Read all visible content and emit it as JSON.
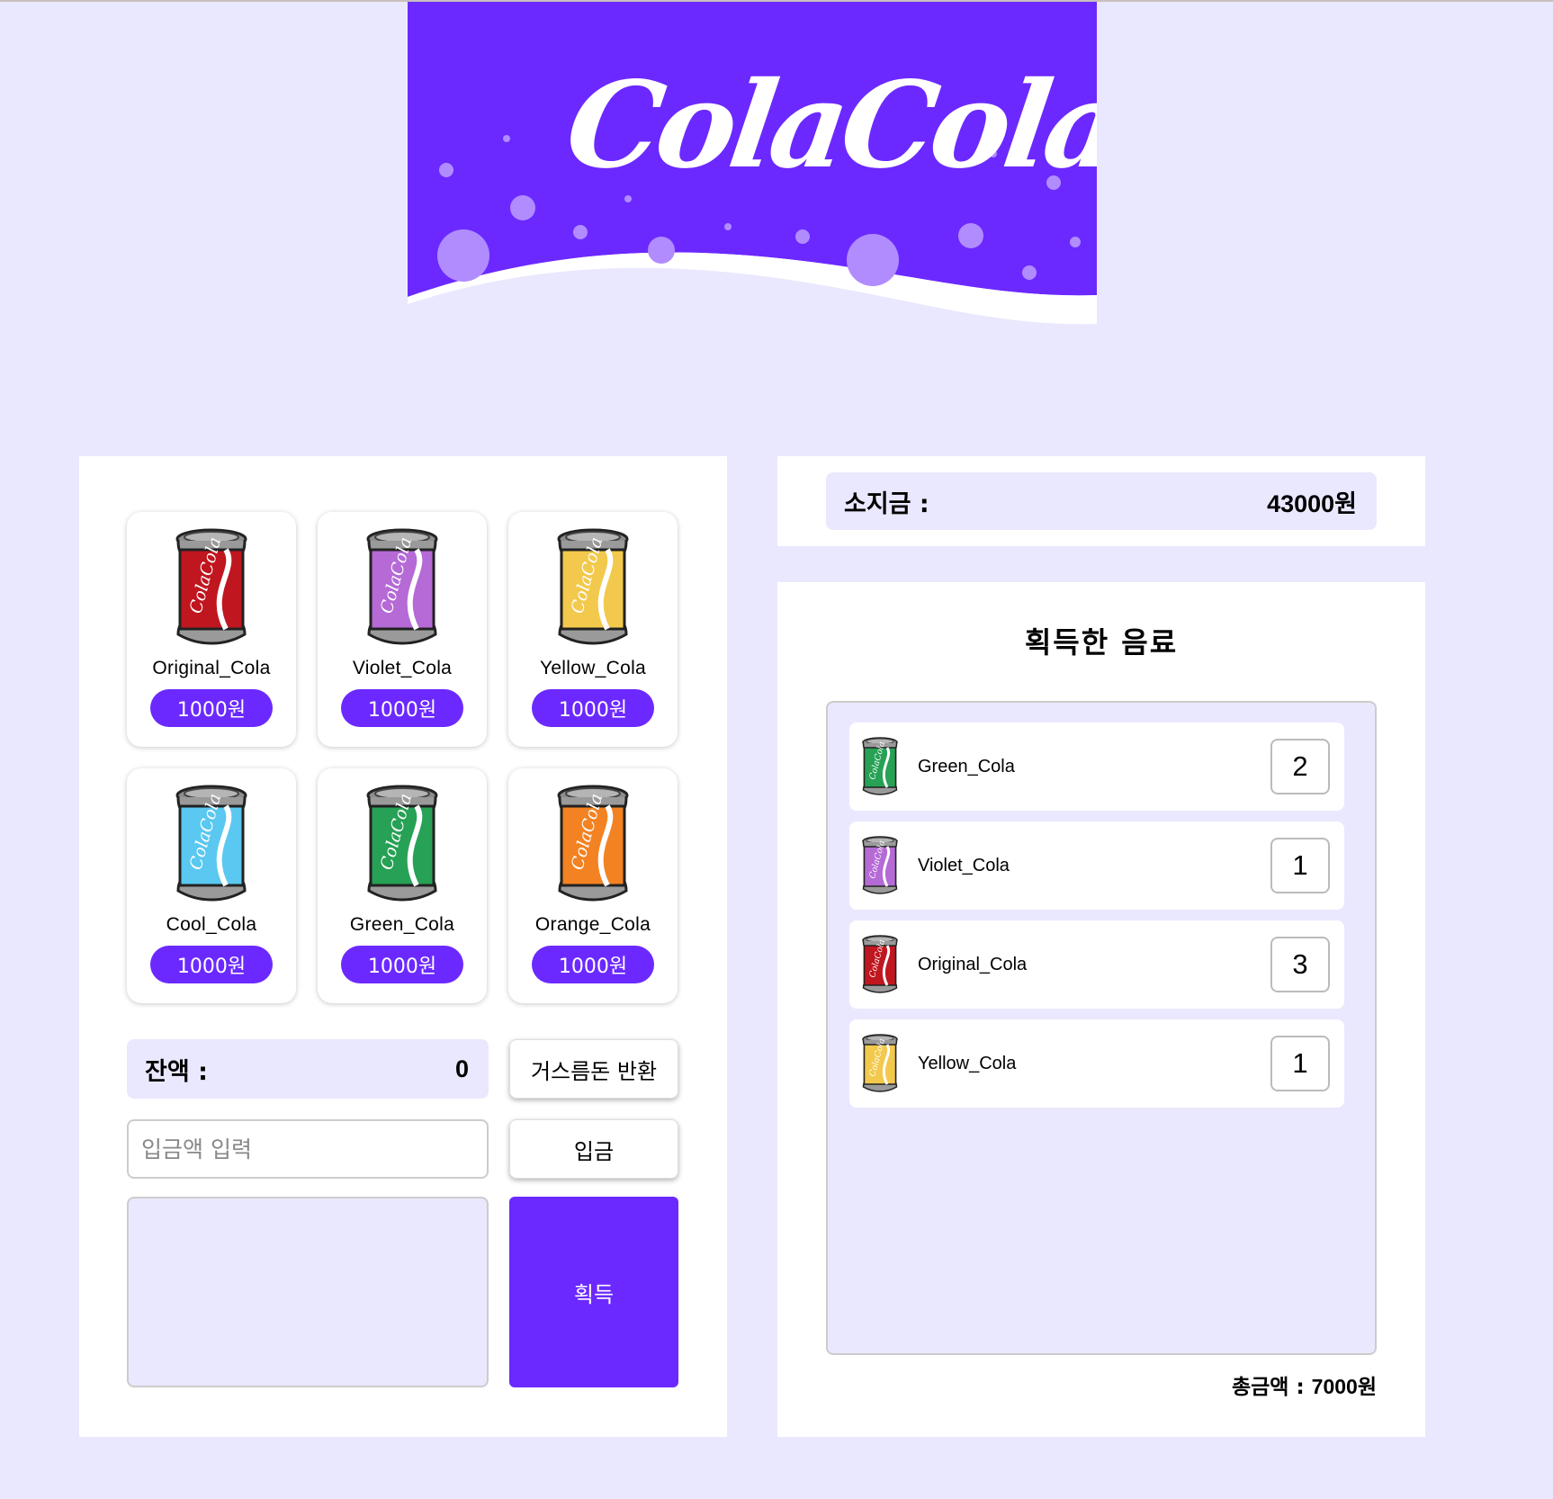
{
  "banner": {
    "logo_text": "ColaCola",
    "background_color": "#6b29ff"
  },
  "products": [
    {
      "name": "Original_Cola",
      "price": "1000원",
      "color": "#c0161f",
      "icon": "original-cola-can-icon"
    },
    {
      "name": "Violet_Cola",
      "price": "1000원",
      "color": "#b56ad6",
      "icon": "violet-cola-can-icon"
    },
    {
      "name": "Yellow_Cola",
      "price": "1000원",
      "color": "#f2c94c",
      "icon": "yellow-cola-can-icon"
    },
    {
      "name": "Cool_Cola",
      "price": "1000원",
      "color": "#5ac8f0",
      "icon": "cool-cola-can-icon"
    },
    {
      "name": "Green_Cola",
      "price": "1000원",
      "color": "#27a155",
      "icon": "green-cola-can-icon"
    },
    {
      "name": "Orange_Cola",
      "price": "1000원",
      "color": "#f28222",
      "icon": "orange-cola-can-icon"
    }
  ],
  "controls": {
    "balance_label": "잔액 :",
    "balance_value": "0",
    "return_change_label": "거스름돈 반환",
    "deposit_placeholder": "입금액 입력",
    "deposit_label": "입금",
    "acquire_label": "획득"
  },
  "wallet": {
    "label": "소지금 :",
    "value": "43000원"
  },
  "acquired": {
    "title": "획득한 음료",
    "items": [
      {
        "name": "Green_Cola",
        "qty": "2",
        "color": "#27a155",
        "icon": "green-cola-can-icon"
      },
      {
        "name": "Violet_Cola",
        "qty": "1",
        "color": "#b56ad6",
        "icon": "violet-cola-can-icon"
      },
      {
        "name": "Original_Cola",
        "qty": "3",
        "color": "#c0161f",
        "icon": "original-cola-can-icon"
      },
      {
        "name": "Yellow_Cola",
        "qty": "1",
        "color": "#f2c94c",
        "icon": "yellow-cola-can-icon"
      }
    ],
    "total_label": "총금액 :",
    "total_value": "7000원"
  },
  "accent_color": "#6b29ff",
  "page_background": "#eae8fe"
}
